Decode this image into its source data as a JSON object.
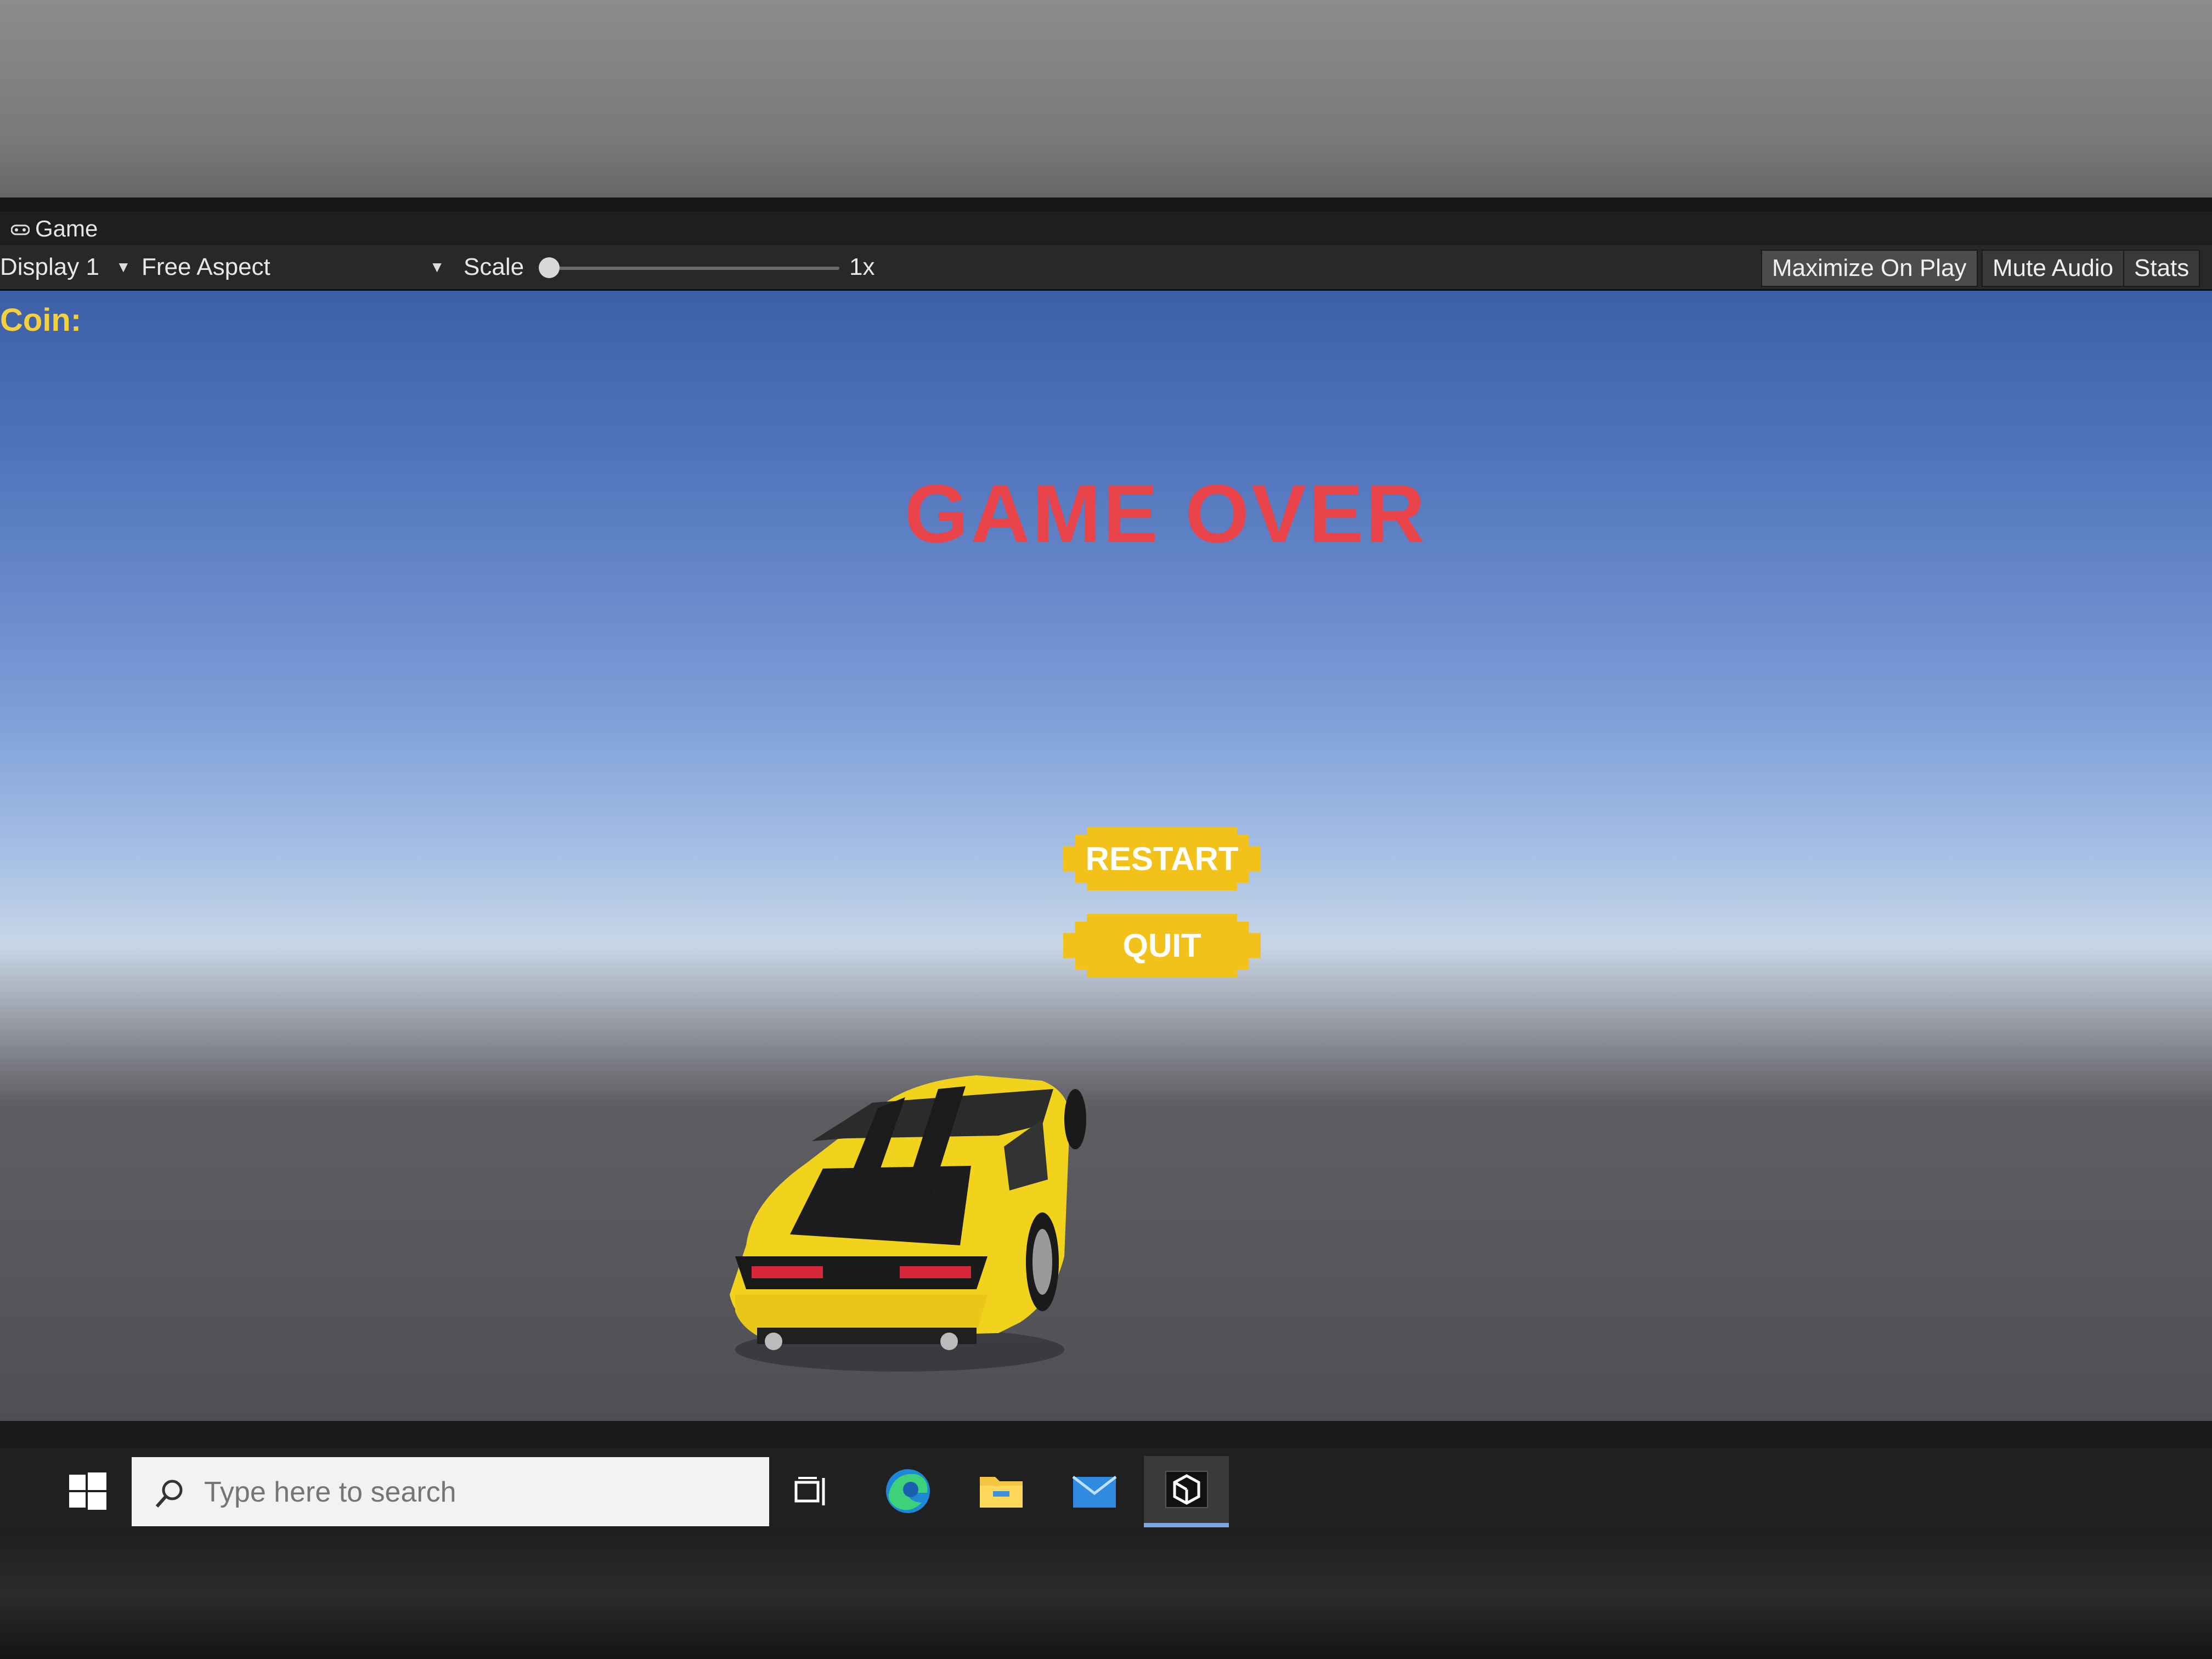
{
  "editor": {
    "tab_title": "Game",
    "toolbar": {
      "display": "Display 1",
      "aspect": "Free Aspect",
      "scale_label": "Scale",
      "scale_value": "1x",
      "maximize_on_play": "Maximize On Play",
      "mute_audio": "Mute Audio",
      "stats": "Stats"
    }
  },
  "game": {
    "coin_label": "Coin:",
    "title": "GAME OVER",
    "restart_label": "RESTART",
    "quit_label": "QUIT",
    "title_color": "#e8444a",
    "button_color": "#f2c21b",
    "car_color": "#f1d21c"
  },
  "taskbar": {
    "search_placeholder": "Type here to search",
    "icons": [
      "windows-start-icon",
      "search-icon",
      "task-view-icon",
      "edge-icon",
      "file-explorer-icon",
      "mail-icon",
      "unity-icon"
    ]
  }
}
